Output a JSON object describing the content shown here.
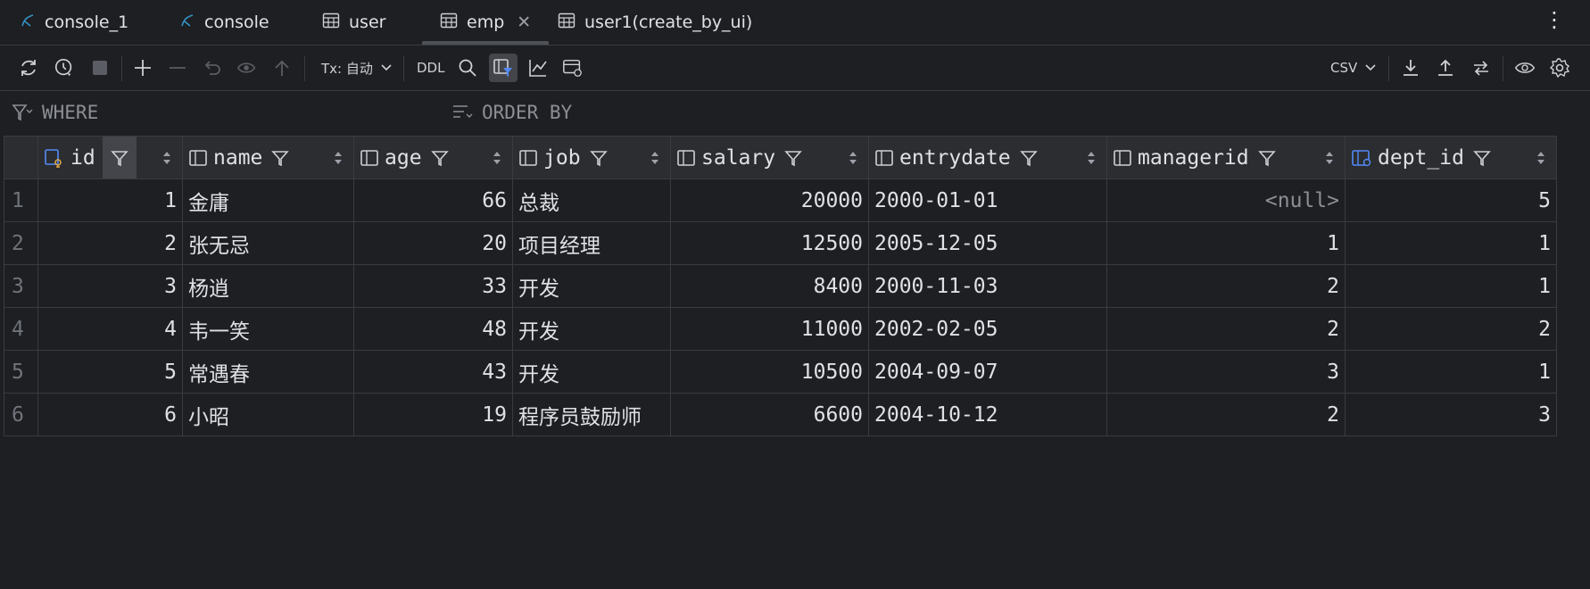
{
  "tabs": [
    {
      "label": "console_1",
      "icon": "mysql-console-icon",
      "active": false
    },
    {
      "label": "console",
      "icon": "mysql-console-icon",
      "active": false
    },
    {
      "label": "user",
      "icon": "table-icon",
      "active": false
    },
    {
      "label": "emp",
      "icon": "table-icon",
      "active": true
    },
    {
      "label": "user1(create_by_ui)",
      "icon": "table-icon",
      "active": false
    }
  ],
  "toolbar": {
    "tx_label": "Tx: 自动",
    "ddl_label": "DDL",
    "export_format": "CSV"
  },
  "filter": {
    "where_label": "WHERE",
    "order_by_label": "ORDER BY"
  },
  "columns": [
    {
      "name": "id",
      "type": "key"
    },
    {
      "name": "name",
      "type": "col"
    },
    {
      "name": "age",
      "type": "col"
    },
    {
      "name": "job",
      "type": "col"
    },
    {
      "name": "salary",
      "type": "col"
    },
    {
      "name": "entrydate",
      "type": "col"
    },
    {
      "name": "managerid",
      "type": "col"
    },
    {
      "name": "dept_id",
      "type": "fk"
    }
  ],
  "rows": [
    {
      "rownum": "1",
      "id": "1",
      "name": "金庸",
      "age": "66",
      "job": "总裁",
      "salary": "20000",
      "entrydate": "2000-01-01",
      "managerid": "<null>",
      "dept_id": "5"
    },
    {
      "rownum": "2",
      "id": "2",
      "name": "张无忌",
      "age": "20",
      "job": "项目经理",
      "salary": "12500",
      "entrydate": "2005-12-05",
      "managerid": "1",
      "dept_id": "1"
    },
    {
      "rownum": "3",
      "id": "3",
      "name": "杨逍",
      "age": "33",
      "job": "开发",
      "salary": "8400",
      "entrydate": "2000-11-03",
      "managerid": "2",
      "dept_id": "1"
    },
    {
      "rownum": "4",
      "id": "4",
      "name": "韦一笑",
      "age": "48",
      "job": "开发",
      "salary": "11000",
      "entrydate": "2002-02-05",
      "managerid": "2",
      "dept_id": "2"
    },
    {
      "rownum": "5",
      "id": "5",
      "name": "常遇春",
      "age": "43",
      "job": "开发",
      "salary": "10500",
      "entrydate": "2004-09-07",
      "managerid": "3",
      "dept_id": "1"
    },
    {
      "rownum": "6",
      "id": "6",
      "name": "小昭",
      "age": "19",
      "job": "程序员鼓励师",
      "salary": "6600",
      "entrydate": "2004-10-12",
      "managerid": "2",
      "dept_id": "3"
    }
  ],
  "colors": {
    "background": "#1e1f22",
    "header_bg": "#2b2d30",
    "accent": "#548af7",
    "null_text": "#8c8f96"
  }
}
